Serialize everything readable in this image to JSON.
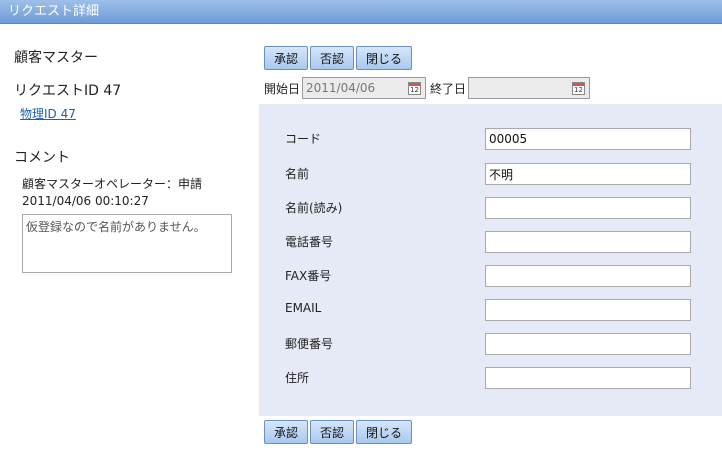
{
  "window": {
    "title": "リクエスト詳細"
  },
  "sidebar": {
    "app_name": "顧客マスター",
    "request_id": "リクエストID 47",
    "physical_id_link": "物理ID 47",
    "comment_heading": "コメント",
    "comment_author": "顧客マスターオペレーター：申請",
    "comment_time": "2011/04/06 00:10:27",
    "comment_text": "仮登録なので名前がありません。"
  },
  "actions": {
    "approve": "承認",
    "reject": "否認",
    "close": "閉じる"
  },
  "dates": {
    "start_label": "開始日",
    "start_value": "2011/04/06",
    "end_label": "終了日",
    "end_value": ""
  },
  "form": {
    "code": {
      "label": "コード",
      "value": "00005"
    },
    "name": {
      "label": "名前",
      "value": "不明"
    },
    "name_reading": {
      "label": "名前(読み)",
      "value": ""
    },
    "phone": {
      "label": "電話番号",
      "value": ""
    },
    "fax": {
      "label": "FAX番号",
      "value": ""
    },
    "email": {
      "label": "EMAIL",
      "value": ""
    },
    "postal": {
      "label": "郵便番号",
      "value": ""
    },
    "address": {
      "label": "住所",
      "value": ""
    }
  }
}
